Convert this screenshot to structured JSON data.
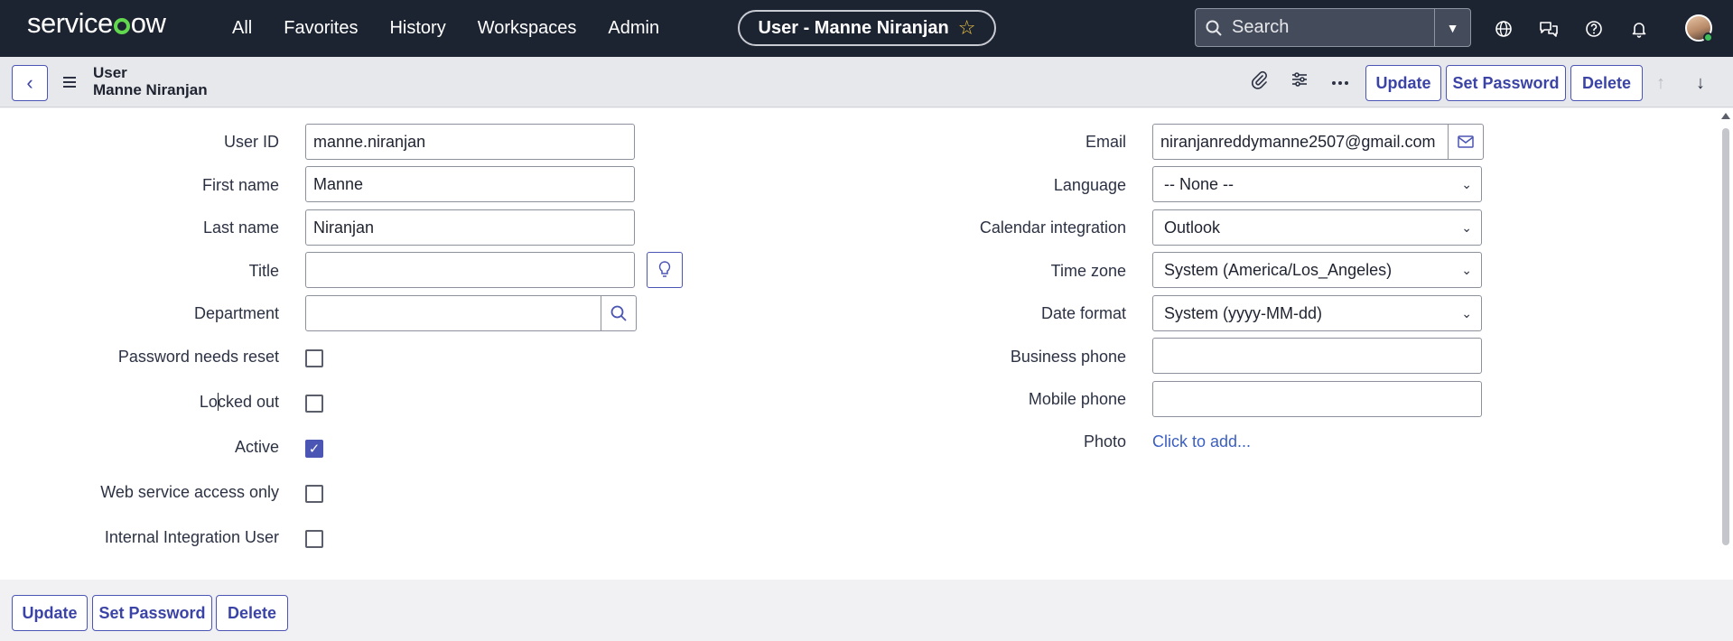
{
  "nav": {
    "brand": "servicenow",
    "links": [
      "All",
      "Favorites",
      "History",
      "Workspaces",
      "Admin"
    ],
    "context_title": "User - Manne Niranjan",
    "search_placeholder": "Search",
    "icons": [
      "globe-icon",
      "chat-icon",
      "help-icon",
      "bell-icon"
    ]
  },
  "header": {
    "record_type": "User",
    "record_name": "Manne Niranjan",
    "buttons": {
      "update": "Update",
      "set_password": "Set Password",
      "delete": "Delete"
    }
  },
  "form": {
    "left": {
      "user_id": {
        "label": "User ID",
        "value": "manne.niranjan"
      },
      "first_name": {
        "label": "First name",
        "value": "Manne"
      },
      "last_name": {
        "label": "Last name",
        "value": "Niranjan"
      },
      "title": {
        "label": "Title",
        "value": ""
      },
      "department": {
        "label": "Department",
        "value": ""
      },
      "password_needs_reset": {
        "label": "Password needs reset",
        "checked": false
      },
      "locked_out": {
        "label": "Locked out",
        "checked": false
      },
      "active": {
        "label": "Active",
        "checked": true
      },
      "web_service_access_only": {
        "label": "Web service access only",
        "checked": false
      },
      "internal_integration_user": {
        "label": "Internal Integration User",
        "checked": false
      }
    },
    "right": {
      "email": {
        "label": "Email",
        "value": "niranjanreddymanne2507@gmail.com"
      },
      "language": {
        "label": "Language",
        "value": "-- None --"
      },
      "calendar_integration": {
        "label": "Calendar integration",
        "value": "Outlook"
      },
      "time_zone": {
        "label": "Time zone",
        "value": "System (America/Los_Angeles)"
      },
      "date_format": {
        "label": "Date format",
        "value": "System (yyyy-MM-dd)"
      },
      "business_phone": {
        "label": "Business phone",
        "value": ""
      },
      "mobile_phone": {
        "label": "Mobile phone",
        "value": ""
      },
      "photo": {
        "label": "Photo",
        "link": "Click to add..."
      }
    }
  },
  "footer": {
    "buttons": {
      "update": "Update",
      "set_password": "Set Password",
      "delete": "Delete"
    }
  },
  "colors": {
    "nav_bg": "#1c2331",
    "accent": "#4b55b3",
    "brand_green": "#62d84e",
    "link": "#3b5fc0"
  }
}
